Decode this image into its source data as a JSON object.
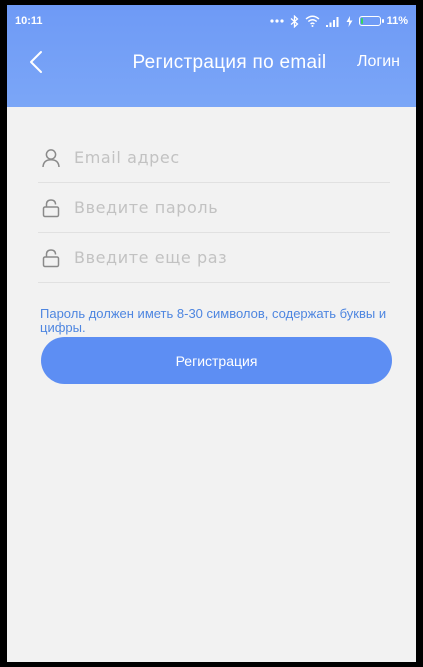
{
  "status_bar": {
    "time": "10:11",
    "battery_percent": "11%",
    "icons": [
      "more-dots-icon",
      "bluetooth-icon",
      "wifi-icon",
      "signal-icon",
      "charging-icon",
      "battery-icon"
    ]
  },
  "header": {
    "title": "Регистрация по email",
    "login_label": "Логин"
  },
  "form": {
    "email": {
      "placeholder": "Email адрес",
      "value": ""
    },
    "password": {
      "placeholder": "Введите пароль",
      "value": ""
    },
    "password_repeat": {
      "placeholder": "Введите еще раз",
      "value": ""
    },
    "hint": "Пароль должен иметь 8-30 символов, содержать буквы и цифры.",
    "submit_label": "Регистрация"
  },
  "colors": {
    "accent": "#5d8ef3",
    "header": "#7ba6f7",
    "hint_text": "#4e86e0",
    "background": "#f2f2f2",
    "battery_fill": "#35d65a"
  }
}
